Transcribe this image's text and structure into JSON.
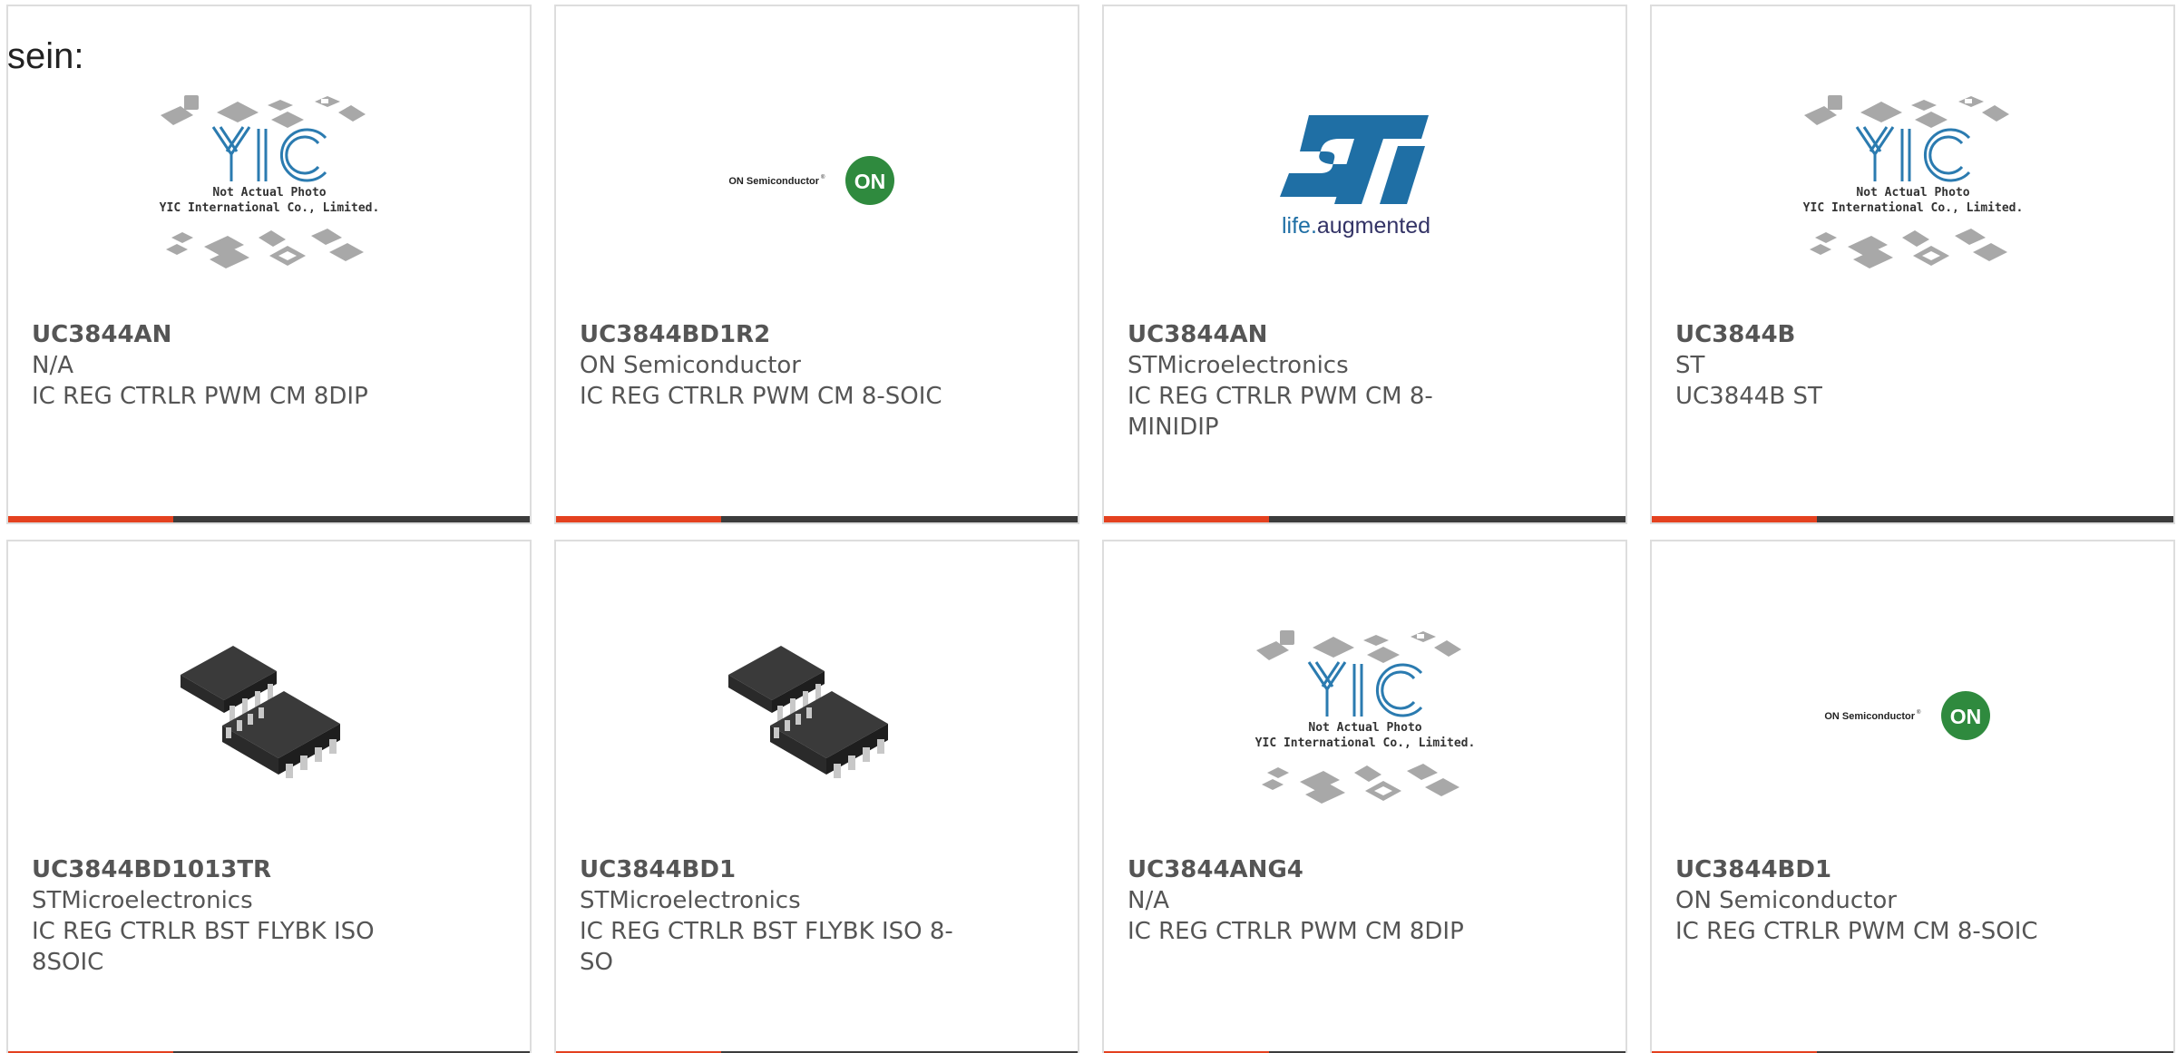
{
  "intro_text": "sein:",
  "colors": {
    "accent": "#e4411f",
    "bar_dark": "#3c3c3c",
    "text": "#555555",
    "border": "#dddddd",
    "on_green": "#2f8a3e",
    "st_blue": "#1f6fa5"
  },
  "logos": {
    "yic_caption_1": "Not Actual Photo",
    "yic_caption_2": "YIC International Co., Limited.",
    "on_semi_text": "ON Semiconductor",
    "on_badge": "ON",
    "st_tagline_prefix": "life.",
    "st_tagline_suffix": "augmented"
  },
  "products": [
    {
      "part_number": "UC3844AN",
      "manufacturer": "N/A",
      "description": "IC REG CTRLR PWM CM 8DIP",
      "image_type": "yic-placeholder"
    },
    {
      "part_number": "UC3844BD1R2",
      "manufacturer": "ON Semiconductor",
      "description": "IC REG CTRLR PWM CM 8-SOIC",
      "image_type": "on-semiconductor-logo"
    },
    {
      "part_number": "UC3844AN",
      "manufacturer": "STMicroelectronics",
      "description": "IC REG CTRLR PWM CM 8-MINIDIP",
      "image_type": "st-logo"
    },
    {
      "part_number": "UC3844B",
      "manufacturer": "ST",
      "description": "UC3844B ST",
      "image_type": "yic-placeholder"
    },
    {
      "part_number": "UC3844BD1013TR",
      "manufacturer": "STMicroelectronics",
      "description": "IC REG CTRLR BST FLYBK ISO 8SOIC",
      "image_type": "soic-chip-photo"
    },
    {
      "part_number": "UC3844BD1",
      "manufacturer": "STMicroelectronics",
      "description": "IC REG CTRLR BST FLYBK ISO 8-SO",
      "image_type": "soic-chip-photo"
    },
    {
      "part_number": "UC3844ANG4",
      "manufacturer": "N/A",
      "description": "IC REG CTRLR PWM CM 8DIP",
      "image_type": "yic-placeholder"
    },
    {
      "part_number": "UC3844BD1",
      "manufacturer": "ON Semiconductor",
      "description": "IC REG CTRLR PWM CM 8-SOIC",
      "image_type": "on-semiconductor-logo"
    }
  ]
}
